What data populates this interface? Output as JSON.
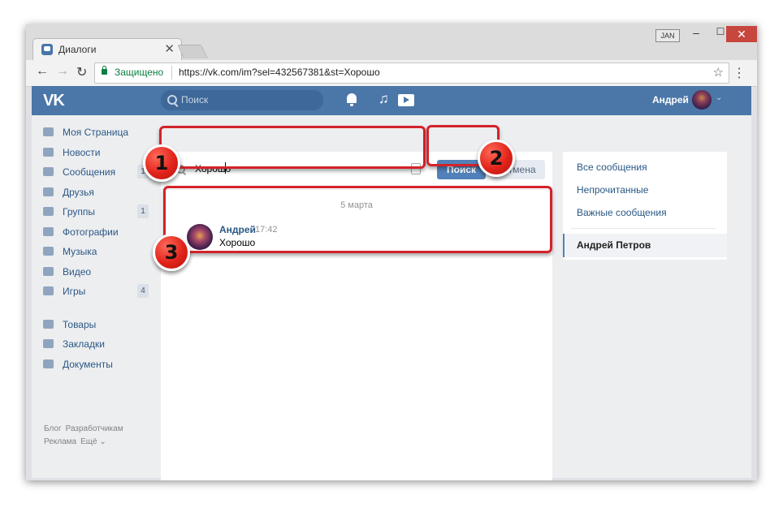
{
  "browser": {
    "tab_title": "Диалоги",
    "tab_close": "✕",
    "window_user": "JAN",
    "min": "–",
    "max": "☐",
    "close": "✕",
    "back": "←",
    "forward": "→",
    "reload": "↻",
    "secure_label": "Защищено",
    "url": "https://vk.com/im?sel=432567381&st=Хорошо",
    "star": "☆",
    "menu": "⋮"
  },
  "header": {
    "logo": "VK",
    "search_placeholder": "Поиск",
    "music": "♫",
    "user_name": "Андрей",
    "chevron": "⌄"
  },
  "sidebar": {
    "items": [
      {
        "label": "Моя Страница",
        "badge": ""
      },
      {
        "label": "Новости",
        "badge": ""
      },
      {
        "label": "Сообщения",
        "badge": "1"
      },
      {
        "label": "Друзья",
        "badge": ""
      },
      {
        "label": "Группы",
        "badge": "1"
      },
      {
        "label": "Фотографии",
        "badge": ""
      },
      {
        "label": "Музыка",
        "badge": ""
      },
      {
        "label": "Видео",
        "badge": ""
      },
      {
        "label": "Игры",
        "badge": "4"
      }
    ],
    "items2": [
      {
        "label": "Товары"
      },
      {
        "label": "Закладки"
      },
      {
        "label": "Документы"
      }
    ],
    "footer": {
      "blog": "Блог",
      "dev": "Разработчикам",
      "ads": "Реклама",
      "more": "Ещё ⌄"
    }
  },
  "search": {
    "query": "Хорошо",
    "search_button": "Поиск",
    "cancel_button": "Отмена"
  },
  "results": {
    "date": "5 марта",
    "message": {
      "author": "Андрей",
      "time": "17:42",
      "text": "Хорошо"
    }
  },
  "right_menu": {
    "all": "Все сообщения",
    "unread": "Непрочитанные",
    "important": "Важные сообщения",
    "active": "Андрей Петров"
  },
  "annotations": {
    "one": "1",
    "two": "2",
    "three": "3",
    "color": "#d3232a"
  }
}
